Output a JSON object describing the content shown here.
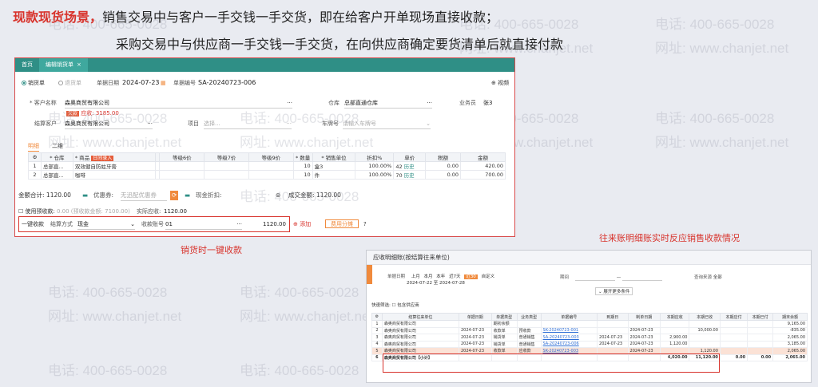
{
  "header": {
    "line1_highlight": "现款现货场景，",
    "line1_rest": "销售交易中与客户一手交钱一手交货，即在给客户开单现场直接收款；",
    "line2": "采购交易中与供应商一手交钱一手交货，在向供应商确定要货清单后就直接付款"
  },
  "watermark": {
    "phone": "电话: 400-665-0028",
    "site": "网址: www.chanjet.net"
  },
  "sales": {
    "tabs": [
      {
        "label": "首页"
      },
      {
        "label": "编辑销货单",
        "close": "×"
      }
    ],
    "doc_types": [
      "销货单",
      "退货单"
    ],
    "date_label": "单据日期",
    "date_value": "2024-07-23",
    "docno_label": "单据编号",
    "docno_value": "SA-20240723-006",
    "view_label": "视频",
    "customer_label": "* 客户名称",
    "customer_value": "森奥商贸有限公司",
    "receivable_badge": "欠款",
    "receivable_text": "应收: 3185.00",
    "warehouse_label": "仓库",
    "warehouse_value": "总部直通仓库",
    "salesman_label": "业务员",
    "salesman_value": "张3",
    "settle_label": "结算客户",
    "settle_value": "森奥商贸有限公司",
    "project_label": "项目",
    "project_placeholder": "选择...",
    "plate_label": "车牌号",
    "plate_placeholder": "请输入车牌号",
    "subtabs": [
      "明细",
      "二维"
    ],
    "new_badge": "日间录入",
    "columns": [
      "",
      "* 仓库",
      "* 商品",
      "",
      "等级6价",
      "等级7价",
      "等级9价",
      "* 数量",
      "* 销售单位",
      "折扣%",
      "单价",
      "税额",
      "金额"
    ],
    "rows": [
      {
        "no": "1",
        "wh": "总部直...",
        "item": "双效健自防蛀牙膏",
        "qty": "10",
        "unit": "盒3",
        "disc": "100.00%",
        "price": "42",
        "hist": "历史",
        "tax": "0.00",
        "amount": "420.00"
      },
      {
        "no": "2",
        "wh": "总部直...",
        "item": "咖啡",
        "qty": "10",
        "unit": "件",
        "disc": "100.00%",
        "price": "70",
        "hist": "历史",
        "tax": "0.00",
        "amount": "700.00"
      }
    ],
    "total_label": "金额合计: ",
    "total_value": "1120.00",
    "coupon_label": "优惠券:",
    "coupon_placeholder": "无迅配优惠券",
    "cash_discount_label": "现金折扣:",
    "deal_label": "成交金额:",
    "deal_value": "1120.00",
    "prepay_label": "使用预收款:",
    "prepay_value": "0.00 (预收款金额: 7100.00)",
    "actual_label": "实际应收:",
    "actual_value": "1120.00",
    "onekey_label": "一键收款",
    "method_label": "结算方式",
    "method_value": "现金",
    "account_label": "收款账号",
    "account_value": "01",
    "pay_amount": "1120.00",
    "add_label": "添加",
    "fee_label": "费用分摊"
  },
  "captions": {
    "left": "销货时一键收款",
    "right": "往来账明细账实时反应销售收款情况"
  },
  "ledger": {
    "title": "应收明细账(按结算往来单位)",
    "date_label": "单据日期",
    "date_chips": [
      "上月",
      "本月",
      "本年",
      "近7天",
      "近30",
      "自定义"
    ],
    "date_range": "2024-07-22 至 2024-07-28",
    "period_label": "期间",
    "source_label": "查询来源",
    "source_value": "全部",
    "expand_label": "展开更多条件",
    "quick_label": "快速筛选:",
    "quick_option": "包含供应商",
    "columns": [
      "",
      "结算往来单位",
      "单据日期",
      "单据类型",
      "业务类型",
      "单据编号",
      "到期日",
      "制单日期",
      "本期应收",
      "本期已收",
      "本期应付",
      "本期已付",
      "期末余额"
    ],
    "rows": [
      {
        "no": "1",
        "unit": "森奥商贸有限公司",
        "date": "",
        "type": "期初余额",
        "biz": "",
        "docno": "",
        "due": "",
        "made": "",
        "recv": "",
        "got": "",
        "pay": "",
        "paid": "",
        "bal": "9,165.00"
      },
      {
        "no": "2",
        "unit": "森奥商贸有限公司",
        "date": "2024-07-23",
        "type": "收款单",
        "biz": "预收款",
        "docno": "SK-20240723-001",
        "due": "",
        "made": "2024-07-23",
        "recv": "",
        "got": "10,000.00",
        "pay": "",
        "paid": "",
        "bal": "-835.00"
      },
      {
        "no": "3",
        "unit": "森奥商贸有限公司",
        "date": "2024-07-23",
        "type": "销货单",
        "biz": "普通销售",
        "docno": "SA-20240723-003",
        "due": "2024-07-23",
        "made": "2024-07-23",
        "recv": "2,900.00",
        "got": "",
        "pay": "",
        "paid": "",
        "bal": "2,065.00"
      },
      {
        "no": "4",
        "unit": "森奥商贸有限公司",
        "date": "2024-07-23",
        "type": "销货单",
        "biz": "普通销售",
        "docno": "SA-20240723-006",
        "due": "2024-07-23",
        "made": "2024-07-23",
        "recv": "1,120.00",
        "got": "",
        "pay": "",
        "paid": "",
        "bal": "3,185.00"
      },
      {
        "no": "5",
        "unit": "森奥商贸有限公司",
        "date": "2024-07-23",
        "type": "收款单",
        "biz": "应收款",
        "docno": "SK-20240723-003",
        "due": "",
        "made": "2024-07-23",
        "recv": "",
        "got": "1,120.00",
        "pay": "",
        "paid": "",
        "bal": "2,065.00"
      },
      {
        "no": "6",
        "unit": "森奥商贸有限公司【小计】",
        "date": "",
        "type": "",
        "biz": "",
        "docno": "",
        "due": "",
        "made": "",
        "recv": "4,020.00",
        "got": "11,120.00",
        "pay": "0.00",
        "paid": "0.00",
        "bal": "2,065.00"
      }
    ]
  }
}
